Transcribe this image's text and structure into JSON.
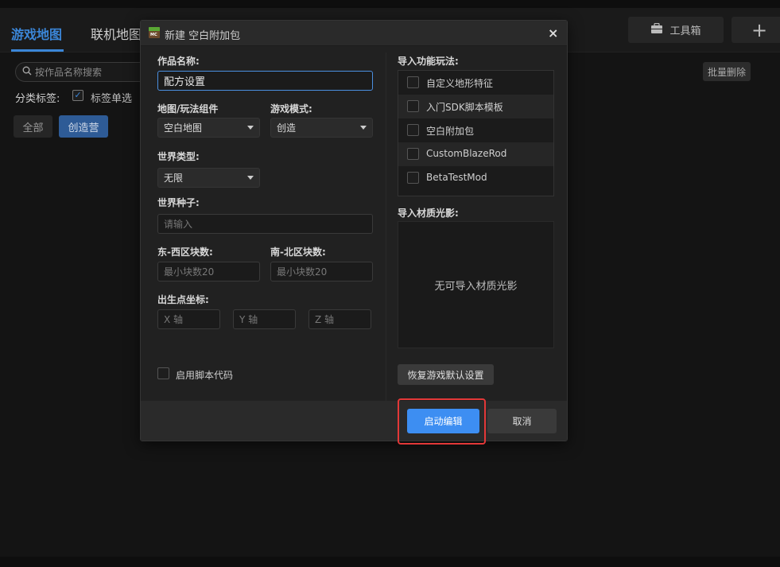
{
  "app": {
    "tabs": [
      {
        "label": "游戏地图"
      },
      {
        "label": "联机地图"
      }
    ],
    "toolbox_label": "工具箱",
    "add_label": "+",
    "search_placeholder": "按作品名称搜索",
    "filter_label": "分类标签:",
    "filter_check_label": "标签单选",
    "filter_check_mark": "✓",
    "categories": [
      "全部",
      "创造营"
    ],
    "batch_delete_label": "批量删除"
  },
  "dialog": {
    "title": "新建 空白附加包",
    "close": "×",
    "icon_text": "MC",
    "name_label": "作品名称:",
    "name_value": "配方设置",
    "map_label": "地图/玩法组件",
    "map_value": "空白地图",
    "mode_label": "游戏模式:",
    "mode_value": "创造",
    "world_type_label": "世界类型:",
    "world_type_value": "无限",
    "seed_label": "世界种子:",
    "seed_placeholder": "请输入",
    "ew_label": "东-西区块数:",
    "ew_placeholder": "最小块数20",
    "ns_label": "南-北区块数:",
    "ns_placeholder": "最小块数20",
    "spawn_label": "出生点坐标:",
    "x_placeholder": "X 轴",
    "y_placeholder": "Y 轴",
    "z_placeholder": "Z 轴",
    "script_label": "启用脚本代码",
    "features_label": "导入功能玩法:",
    "features": [
      "自定义地形特征",
      "入门SDK脚本模板",
      "空白附加包",
      "CustomBlazeRod",
      "BetaTestMod"
    ],
    "materials_label": "导入材质光影:",
    "materials_empty": "无可导入材质光影",
    "restore_label": "恢复游戏默认设置",
    "start_label": "启动编辑",
    "cancel_label": "取消"
  },
  "colors": {
    "accent": "#3d8ef2",
    "highlight": "#e33838"
  }
}
